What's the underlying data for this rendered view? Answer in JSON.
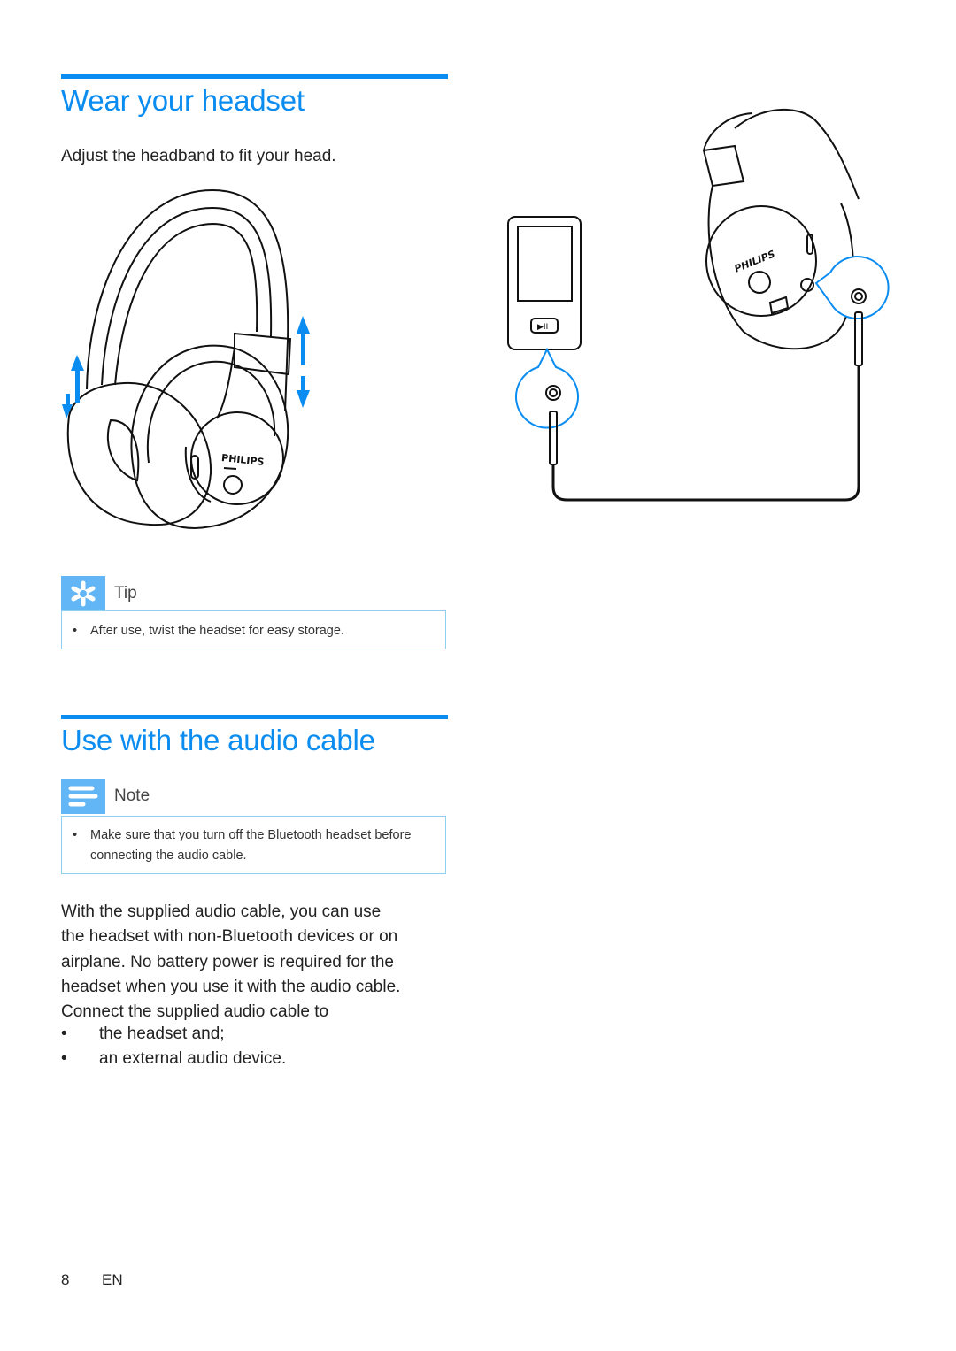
{
  "section1": {
    "title": "Wear your headset",
    "intro": "Adjust the headband to fit your head.",
    "illustration": {
      "description": "headset-with-adjustment-arrows",
      "brand_label": "PHILIPS"
    },
    "tip": {
      "label": "Tip",
      "icon": "asterisk-icon",
      "items": [
        "After use, twist the headset for easy storage."
      ]
    }
  },
  "section2": {
    "title": "Use with the audio cable",
    "note": {
      "label": "Note",
      "icon": "lines-icon",
      "items": [
        "Make sure that you turn off the Bluetooth headset before connecting the audio cable."
      ]
    },
    "paragraph_lines": [
      "With the supplied audio cable, you can use",
      "the headset with non-Bluetooth devices or on",
      "airplane. No battery power is required for the",
      "headset when you use it with the audio cable.",
      "Connect the supplied audio cable to"
    ],
    "bullets": [
      "the headset and;",
      "an external audio device."
    ],
    "illustration": {
      "description": "player-connected-to-headset-via-cable",
      "brand_label": "PHILIPS",
      "player_button": "▶II"
    }
  },
  "footer": {
    "page_number": "8",
    "language": "EN"
  },
  "colors": {
    "accent": "#0a8cf0",
    "callout_icon_bg": "#62b6f5",
    "callout_border": "#8fd0f0"
  },
  "bullet_glyph": "•"
}
